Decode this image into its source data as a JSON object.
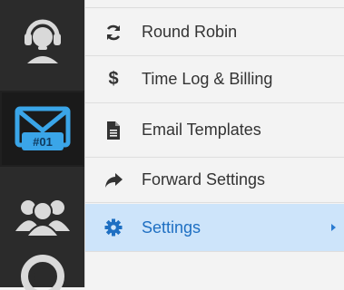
{
  "rail": {
    "items": [
      {
        "icon": "headset-support-icon"
      },
      {
        "icon": "email-inbox-icon",
        "badge": "#01",
        "active": true
      },
      {
        "icon": "users-group-icon"
      },
      {
        "icon": "lifebuoy-icon"
      }
    ]
  },
  "menu": {
    "items": [
      {
        "label": "Round Robin",
        "icon": "refresh-icon"
      },
      {
        "label": "Time Log & Billing",
        "icon": "dollar-icon"
      },
      {
        "label": "Email Templates",
        "icon": "document-icon"
      },
      {
        "label": "Forward Settings",
        "icon": "forward-icon"
      },
      {
        "label": "Settings",
        "icon": "gear-icon",
        "active": true,
        "has_submenu": true
      }
    ]
  },
  "colors": {
    "rail_bg": "#2b2b2b",
    "active_icon": "#3aa5e8",
    "active_item_bg": "#cde4fa",
    "active_item_text": "#1e6fc2"
  }
}
